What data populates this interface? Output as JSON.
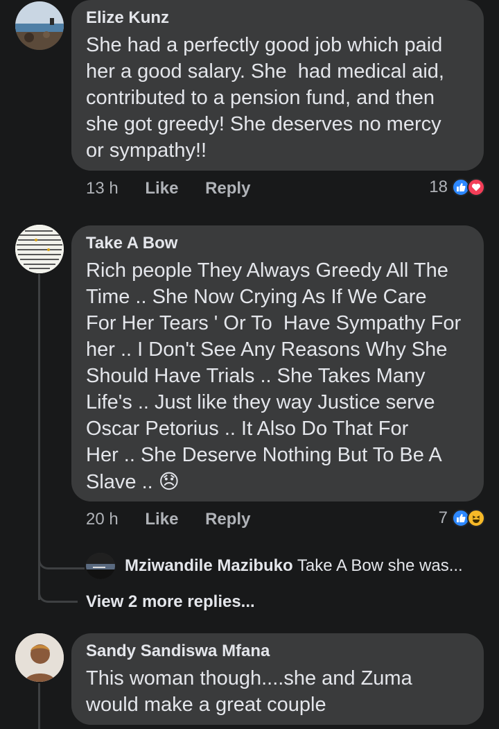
{
  "comments": [
    {
      "author": "Elize Kunz",
      "text": "She had a perfectly good job which paid\nher a good salary. She  had medical aid,\ncontributed to a pension fund, and then\nshe got greedy! She deserves no mercy\nor sympathy!!",
      "time": "13 h",
      "like_label": "Like",
      "reply_label": "Reply",
      "reaction_count": "18",
      "reactions": [
        "like-icon",
        "love-icon"
      ]
    },
    {
      "author": "Take A Bow",
      "text": "Rich people They Always Greedy All The\nTime .. She Now Crying As If We Care\nFor Her Tears ' Or To  Have Sympathy For\nher .. I Don't See Any Reasons Why She\nShould Have Trials .. She Takes Many\nLife's .. Just like they way Justice serve\nOscar Petorius .. It Also Do That For\nHer .. She Deserve Nothing But To Be A\nSlave .. ",
      "emoji": "😞",
      "time": "20 h",
      "like_label": "Like",
      "reply_label": "Reply",
      "reaction_count": "7",
      "reactions": [
        "like-icon",
        "haha-icon"
      ],
      "reply_preview": {
        "author": "Mziwandile Mazibuko",
        "text": "Take A Bow she was..."
      },
      "view_more": "View 2 more replies..."
    },
    {
      "author": "Sandy Sandiswa Mfana",
      "text": "This woman though....she and Zuma\nwould make a great couple"
    }
  ],
  "colors": {
    "background": "#18191a",
    "bubble": "#3a3b3c",
    "like_blue": "#2d88ff",
    "love_red": "#f33e58",
    "haha_yellow": "#f7b928"
  }
}
